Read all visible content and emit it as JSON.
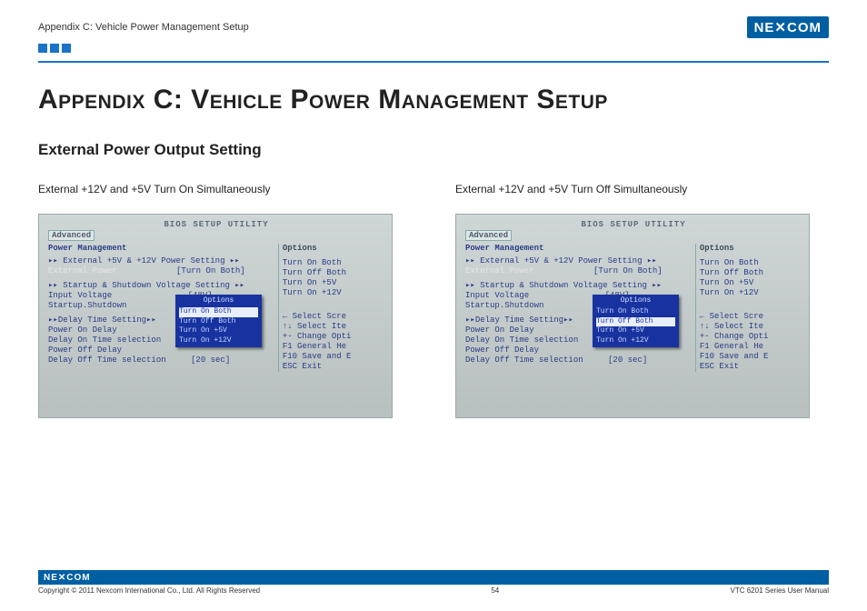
{
  "header": {
    "breadcrumb": "Appendix C: Vehicle Power Management Setup",
    "brand": "NE✕COM"
  },
  "title": "Appendix C: Vehicle Power Management Setup",
  "subtitle": "External Power Output Setting",
  "left_caption": "External +12V and +5V Turn On Simultaneously",
  "right_caption": "External +12V and +5V Turn Off Simultaneously",
  "bios": {
    "title": "BIOS SETUP UTILITY",
    "tab_active": "Advanced",
    "section_hdr": "Power Management",
    "group1": "▸▸ External +5V & +12V Power Setting ▸▸",
    "ext_power_label": "External Power",
    "ext_power_val": "[Turn On  Both]",
    "group2": "▸▸ Startup & Shutdown Voltage Setting ▸▸",
    "input_voltage_label": "Input Voltage",
    "input_voltage_val": "[48V]",
    "startup_shutdown": "Startup.Shutdown",
    "group3": "▸▸Delay Time Setting▸▸",
    "opt1": "Power On Delay",
    "opt2": "Delay On Time selection",
    "opt3": "Power Off Delay",
    "opt4": "Delay Off Time selection",
    "opt4_val": "[20 sec]",
    "right_hdr": "Options",
    "ropt1": "Turn On  Both",
    "ropt2": "Turn Off Both",
    "ropt3": "Turn On  +5V",
    "ropt4": "Turn On +12V",
    "rk1": "←   Select Scre",
    "rk2": "↑↓   Select Ite",
    "rk3": "+-   Change Opti",
    "rk4": "F1   General He",
    "rk5": "F10  Save and E",
    "rk6": "ESC  Exit",
    "popup_title": "Options",
    "popup_o1": "Turn On  Both",
    "popup_o2": "Turn Off Both",
    "popup_o3": "Turn On  +5V",
    "popup_o4": "Turn On +12V"
  },
  "footer": {
    "brand": "NE✕COM",
    "copyright": "Copyright © 2011 Nexcom International Co., Ltd. All Rights Reserved",
    "page": "54",
    "manual": "VTC 6201 Series User Manual"
  }
}
